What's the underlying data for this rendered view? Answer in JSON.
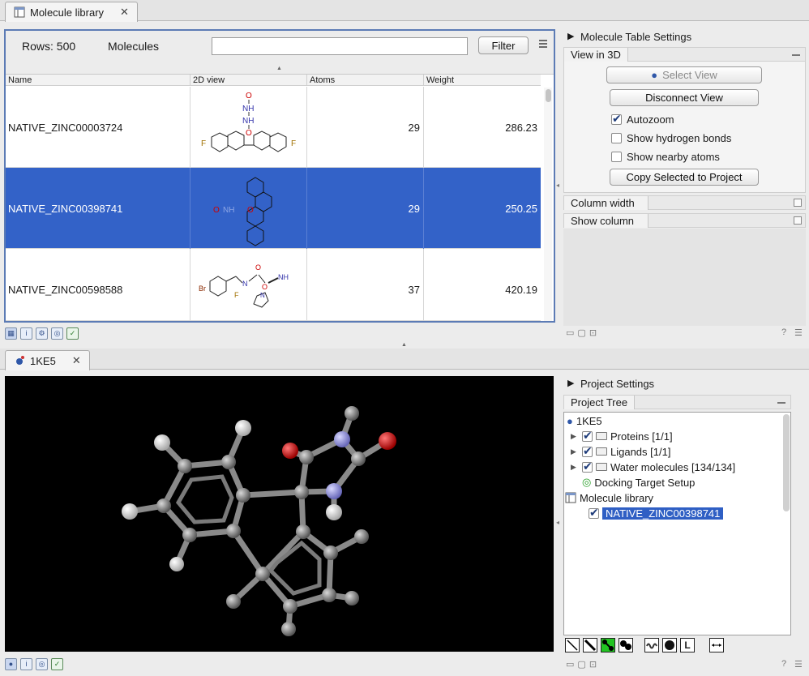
{
  "top_tab": {
    "title": "Molecule library",
    "close": "✕"
  },
  "table": {
    "rows_label": "Rows: 500",
    "mode_label": "Molecules",
    "search_value": "",
    "filter_button": "Filter",
    "columns": [
      "Name",
      "2D view",
      "Atoms",
      "Weight"
    ],
    "rows": [
      {
        "name": "NATIVE_ZINC00003724",
        "atoms": "29",
        "weight": "286.23",
        "selected": false
      },
      {
        "name": "NATIVE_ZINC00398741",
        "atoms": "29",
        "weight": "250.25",
        "selected": true
      },
      {
        "name": "NATIVE_ZINC00598588",
        "atoms": "37",
        "weight": "420.19",
        "selected": false
      }
    ],
    "structure_labels": {
      "r1": {
        "o": "O",
        "nh1": "NH",
        "nh2": "NH",
        "f1": "F",
        "f2": "F",
        "o2": "O"
      },
      "r2": {
        "o": "O",
        "nh": "NH",
        "o2": "O"
      },
      "r3": {
        "br": "Br",
        "n": "N",
        "o": "O",
        "nh": "NH",
        "o2": "O",
        "f": "F",
        "n2": "N"
      }
    }
  },
  "table_settings": {
    "title": "Molecule Table Settings",
    "view3d_header": "View in 3D",
    "select_view": "Select View",
    "disconnect_view": "Disconnect View",
    "autozoom": "Autozoom",
    "show_hbonds": "Show hydrogen bonds",
    "show_nearby": "Show nearby atoms",
    "copy_selected": "Copy Selected to Project",
    "column_width": "Column width",
    "show_column": "Show column"
  },
  "bottom_tab": {
    "title": "1KE5",
    "close": "✕"
  },
  "project_settings": {
    "title": "Project Settings",
    "tree_header": "Project Tree",
    "tree": {
      "root": "1KE5",
      "proteins": "Proteins [1/1]",
      "ligands": "Ligands [1/1]",
      "water": "Water molecules [134/134]",
      "docking": "Docking Target Setup",
      "library": "Molecule library",
      "selected_item": "NATIVE_ZINC00398741"
    }
  },
  "icons": [
    "table-icon",
    "molecule-icon",
    "close-icon",
    "filter-menu-icon",
    "checkbox-icon",
    "folder-icon",
    "help-icon"
  ],
  "colors": {
    "selection": "#3362c8",
    "frame": "#5c7bb5",
    "viewer_bg": "#000000"
  },
  "help": "?"
}
